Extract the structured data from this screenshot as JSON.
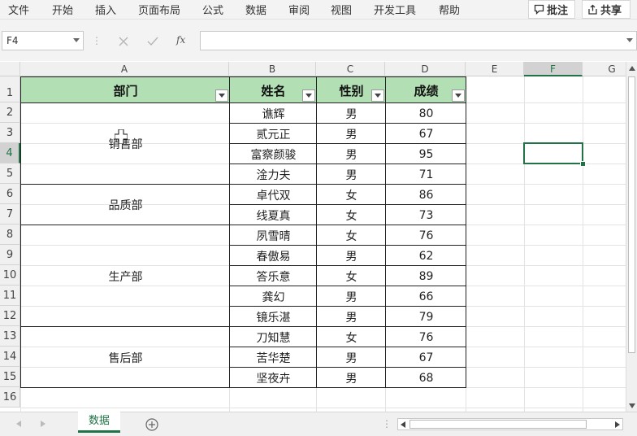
{
  "menu": {
    "items": [
      "文件",
      "开始",
      "插入",
      "页面布局",
      "公式",
      "数据",
      "审阅",
      "视图",
      "开发工具",
      "帮助"
    ],
    "comments_label": "批注",
    "share_label": "共享"
  },
  "formula_bar": {
    "name_box": "F4",
    "fx_label": "fx",
    "formula_value": ""
  },
  "columns": [
    "A",
    "B",
    "C",
    "D",
    "E",
    "F",
    "G"
  ],
  "rows": [
    "1",
    "2",
    "3",
    "4",
    "5",
    "6",
    "7",
    "8",
    "9",
    "10",
    "11",
    "12",
    "13",
    "14",
    "15",
    "16"
  ],
  "selected_cell": "F4",
  "table": {
    "headers": [
      "部门",
      "姓名",
      "性别",
      "成绩"
    ],
    "departments": [
      {
        "name": "销售部",
        "rows": [
          [
            "谯辉",
            "男",
            "80"
          ],
          [
            "贰元正",
            "男",
            "67"
          ],
          [
            "富察颜骏",
            "男",
            "95"
          ],
          [
            "淦力夫",
            "男",
            "71"
          ]
        ]
      },
      {
        "name": "品质部",
        "rows": [
          [
            "卓代双",
            "女",
            "86"
          ],
          [
            "线夏真",
            "女",
            "73"
          ]
        ]
      },
      {
        "name": "生产部",
        "rows": [
          [
            "夙雪晴",
            "女",
            "76"
          ],
          [
            "春傲易",
            "男",
            "62"
          ],
          [
            "答乐意",
            "女",
            "89"
          ],
          [
            "龚幻",
            "男",
            "66"
          ],
          [
            "镜乐湛",
            "男",
            "79"
          ]
        ]
      },
      {
        "name": "售后部",
        "rows": [
          [
            "刀知慧",
            "女",
            "76"
          ],
          [
            "苦华楚",
            "男",
            "67"
          ],
          [
            "坚夜卉",
            "男",
            "68"
          ]
        ]
      }
    ]
  },
  "sheet_tabs": [
    "数据"
  ],
  "colors": {
    "header_fill": "#b3dfb4",
    "accent": "#217346"
  }
}
